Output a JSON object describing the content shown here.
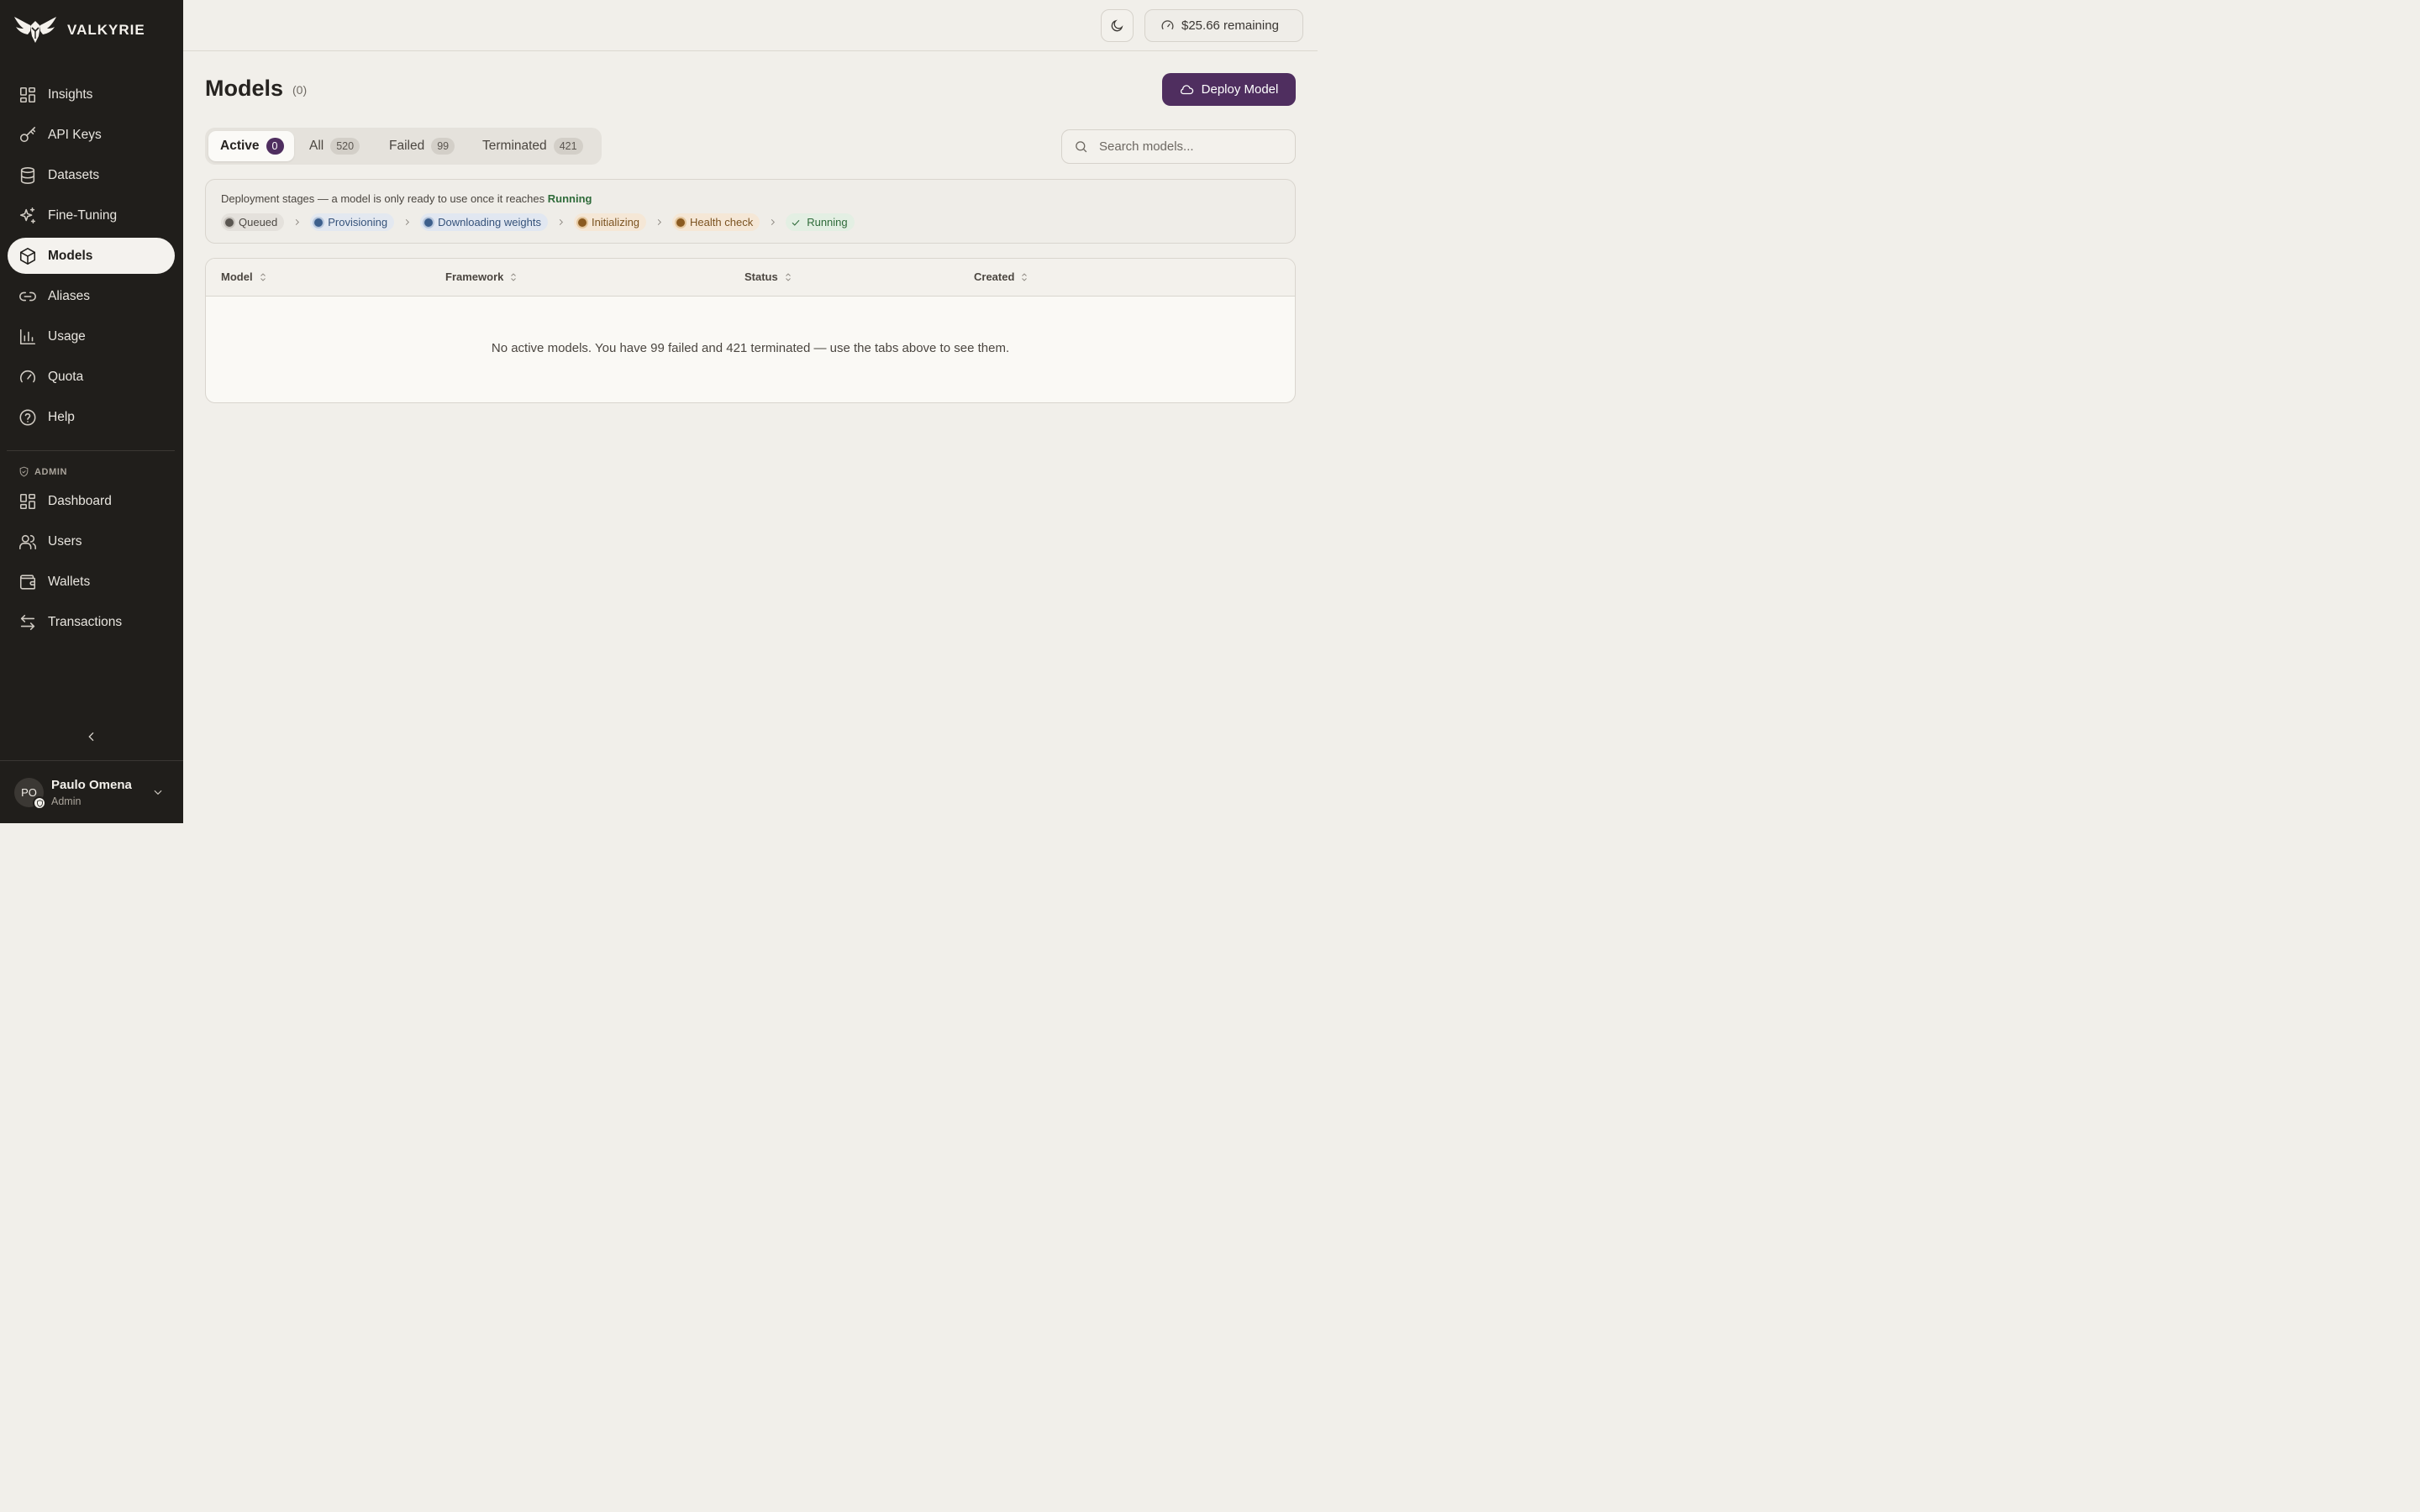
{
  "brand": {
    "name": "VALKYRIE"
  },
  "sidebar": {
    "items": [
      {
        "label": "Insights",
        "icon": "grid-icon"
      },
      {
        "label": "API Keys",
        "icon": "key-icon"
      },
      {
        "label": "Datasets",
        "icon": "database-icon"
      },
      {
        "label": "Fine-Tuning",
        "icon": "sparkles-icon"
      },
      {
        "label": "Models",
        "icon": "cube-icon",
        "active": true
      },
      {
        "label": "Aliases",
        "icon": "link-icon"
      },
      {
        "label": "Usage",
        "icon": "bar-chart-icon"
      },
      {
        "label": "Quota",
        "icon": "gauge-icon"
      },
      {
        "label": "Help",
        "icon": "help-circle-icon"
      }
    ],
    "admin_label": "ADMIN",
    "admin_items": [
      {
        "label": "Dashboard",
        "icon": "grid-icon"
      },
      {
        "label": "Users",
        "icon": "users-icon"
      },
      {
        "label": "Wallets",
        "icon": "wallet-icon"
      },
      {
        "label": "Transactions",
        "icon": "arrows-swap-icon"
      }
    ]
  },
  "user": {
    "initials": "PO",
    "name": "Paulo Omena",
    "role": "Admin"
  },
  "topbar": {
    "credit": "$25.66 remaining"
  },
  "page": {
    "title": "Models",
    "count": "(0)",
    "deploy_label": "Deploy Model"
  },
  "tabs": [
    {
      "label": "Active",
      "count": "0",
      "active": true
    },
    {
      "label": "All",
      "count": "520"
    },
    {
      "label": "Failed",
      "count": "99"
    },
    {
      "label": "Terminated",
      "count": "421"
    }
  ],
  "search": {
    "placeholder": "Search models...",
    "value": ""
  },
  "stages": {
    "note_prefix": "Deployment stages — a model is only ready to use once it reaches",
    "note_emphasis": "Running",
    "items": [
      "Queued",
      "Provisioning",
      "Downloading weights",
      "Initializing",
      "Health check",
      "Running"
    ]
  },
  "table": {
    "columns": [
      "Model",
      "Framework",
      "Status",
      "Created"
    ],
    "rows": [],
    "empty_message": "No active models. You have 99 failed and 421 terminated — use the tabs above to see them."
  },
  "colors": {
    "accent": "#4f2e5f",
    "sidebar_bg": "#201e1b",
    "page_bg": "#f1efea",
    "running": "#2f6b3a"
  }
}
